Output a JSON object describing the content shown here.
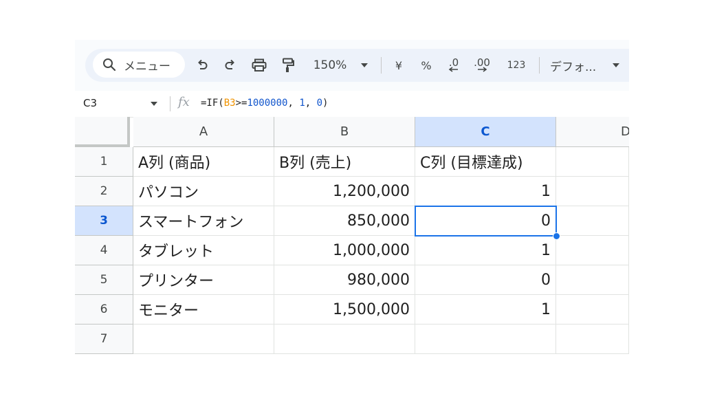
{
  "toolbar": {
    "search_label": "メニュー",
    "zoom": "150%",
    "currency": "¥",
    "percent": "%",
    "decrease_decimal": ".0",
    "increase_decimal": ".00",
    "number_format": "123",
    "font": "デフォ..."
  },
  "formula_bar": {
    "name_box": "C3",
    "fx": "fx",
    "formula_prefix": "=IF(",
    "formula_ref": "B3",
    "formula_op": ">=",
    "formula_num1": "1000000",
    "formula_sep1": ", ",
    "formula_num2": "1",
    "formula_sep2": ", ",
    "formula_num3": "0",
    "formula_suffix": ")"
  },
  "grid": {
    "columns": [
      "A",
      "B",
      "C",
      "D"
    ],
    "rows": [
      "1",
      "2",
      "3",
      "4",
      "5",
      "6",
      "7"
    ],
    "cells": [
      [
        "A列 (商品)",
        "B列 (売上)",
        "C列 (目標達成)"
      ],
      [
        "パソコン",
        "1,200,000",
        "1"
      ],
      [
        "スマートフォン",
        "850,000",
        "0"
      ],
      [
        "タブレット",
        "1,000,000",
        "1"
      ],
      [
        "プリンター",
        "980,000",
        "0"
      ],
      [
        "モニター",
        "1,500,000",
        "1"
      ],
      [
        "",
        "",
        ""
      ]
    ],
    "selected_cell": "C3"
  },
  "colors": {
    "selection": "#1a73e8",
    "header_selected_bg": "#d3e3fd",
    "formula_ref": "#f09300",
    "formula_number": "#1155cc"
  }
}
